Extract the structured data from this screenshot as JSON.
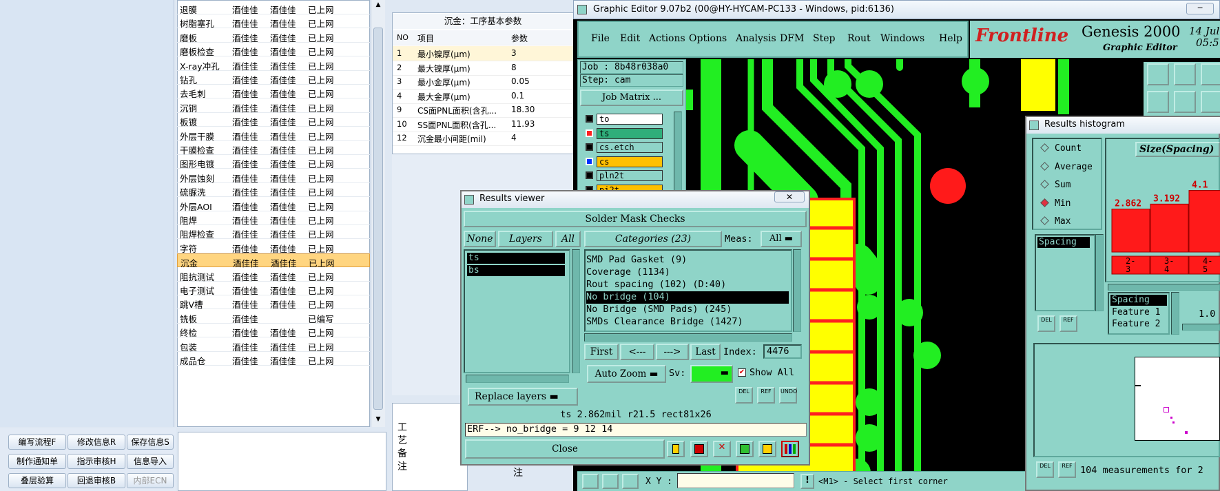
{
  "process_rows": [
    {
      "name": "退膜",
      "a": "酒佳佳",
      "b": "酒佳佳",
      "status": "已上网"
    },
    {
      "name": "树脂塞孔",
      "a": "酒佳佳",
      "b": "酒佳佳",
      "status": "已上网"
    },
    {
      "name": "磨板",
      "a": "酒佳佳",
      "b": "酒佳佳",
      "status": "已上网"
    },
    {
      "name": "磨板检查",
      "a": "酒佳佳",
      "b": "酒佳佳",
      "status": "已上网"
    },
    {
      "name": "X-ray冲孔",
      "a": "酒佳佳",
      "b": "酒佳佳",
      "status": "已上网"
    },
    {
      "name": "钻孔",
      "a": "酒佳佳",
      "b": "酒佳佳",
      "status": "已上网"
    },
    {
      "name": "去毛刺",
      "a": "酒佳佳",
      "b": "酒佳佳",
      "status": "已上网"
    },
    {
      "name": "沉铜",
      "a": "酒佳佳",
      "b": "酒佳佳",
      "status": "已上网"
    },
    {
      "name": "板镀",
      "a": "酒佳佳",
      "b": "酒佳佳",
      "status": "已上网"
    },
    {
      "name": "外层干膜",
      "a": "酒佳佳",
      "b": "酒佳佳",
      "status": "已上网"
    },
    {
      "name": "干膜检查",
      "a": "酒佳佳",
      "b": "酒佳佳",
      "status": "已上网"
    },
    {
      "name": "图形电镀",
      "a": "酒佳佳",
      "b": "酒佳佳",
      "status": "已上网"
    },
    {
      "name": "外层蚀刻",
      "a": "酒佳佳",
      "b": "酒佳佳",
      "status": "已上网"
    },
    {
      "name": "硫脲洗",
      "a": "酒佳佳",
      "b": "酒佳佳",
      "status": "已上网"
    },
    {
      "name": "外层AOI",
      "a": "酒佳佳",
      "b": "酒佳佳",
      "status": "已上网"
    },
    {
      "name": "阻焊",
      "a": "酒佳佳",
      "b": "酒佳佳",
      "status": "已上网"
    },
    {
      "name": "阻焊检查",
      "a": "酒佳佳",
      "b": "酒佳佳",
      "status": "已上网"
    },
    {
      "name": "字符",
      "a": "酒佳佳",
      "b": "酒佳佳",
      "status": "已上网"
    },
    {
      "name": "沉金",
      "a": "酒佳佳",
      "b": "酒佳佳",
      "status": "已上网"
    },
    {
      "name": "阻抗测试",
      "a": "酒佳佳",
      "b": "酒佳佳",
      "status": "已上网"
    },
    {
      "name": "电子测试",
      "a": "酒佳佳",
      "b": "酒佳佳",
      "status": "已上网"
    },
    {
      "name": "跳V槽",
      "a": "酒佳佳",
      "b": "酒佳佳",
      "status": "已上网"
    },
    {
      "name": "铣板",
      "a": "酒佳佳",
      "b": "",
      "status": "已编写"
    },
    {
      "name": "终检",
      "a": "酒佳佳",
      "b": "酒佳佳",
      "status": "已上网"
    },
    {
      "name": "包装",
      "a": "酒佳佳",
      "b": "酒佳佳",
      "status": "已上网"
    },
    {
      "name": "成品仓",
      "a": "酒佳佳",
      "b": "酒佳佳",
      "status": "已上网"
    }
  ],
  "buttons": {
    "write_flow": "编写流程F",
    "modify_info": "修改信息R",
    "save_info": "保存信息S",
    "make_notice": "制作通知单",
    "guide_review": "指示审核H",
    "import_info": "信息导入",
    "stack_calc": "叠层验算",
    "return_review": "回退审核B",
    "internal_ecn": "内部ECN"
  },
  "param": {
    "title": "沉金：工序基本参数",
    "headers": [
      "NO",
      "项目",
      "参数"
    ],
    "rows": [
      {
        "no": "1",
        "item": "最小镍厚(μm)",
        "val": "3"
      },
      {
        "no": "2",
        "item": "最大镍厚(μm)",
        "val": "8"
      },
      {
        "no": "3",
        "item": "最小金厚(μm)",
        "val": "0.05"
      },
      {
        "no": "4",
        "item": "最大金厚(μm)",
        "val": "0.1"
      },
      {
        "no": "9",
        "item": "CS面PNL面积(含孔...",
        "val": "18.30"
      },
      {
        "no": "10",
        "item": "SS面PNL面积(含孔...",
        "val": "11.93"
      },
      {
        "no": "12",
        "item": "沉金最小间距(mil)",
        "val": "4"
      }
    ],
    "craft_label": "工艺备注",
    "craft_note_char": "注"
  },
  "genesis": {
    "title": "Graphic Editor 9.07b2 (00@HY-HYCAM-PC133 - Windows, pid:6136)",
    "menu": [
      "File",
      "Edit",
      "Actions",
      "Options",
      "Analysis",
      "DFM",
      "Step",
      "Rout",
      "Windows",
      "Help"
    ],
    "brand": "Frontline",
    "product": "Genesis 2000",
    "product_sub": "Graphic Editor",
    "date": "14 Jul",
    "time": "05:5",
    "job": "Job : 8b48r038a0",
    "step": "Step: cam",
    "job_matrix": "Job Matrix ...",
    "layers": [
      {
        "name": "to",
        "color": "#ffffff",
        "box": "#000000"
      },
      {
        "name": "ts",
        "color": "#2fae7a",
        "box": "#ff2020"
      },
      {
        "name": "cs.etch",
        "color": "#8fd4c8",
        "box": "#000000"
      },
      {
        "name": "cs",
        "color": "#ffc000",
        "box": "#0033ff"
      },
      {
        "name": "pln2t",
        "color": "#8fd4c8",
        "box": "#000000"
      },
      {
        "name": "pi2t",
        "color": "#ffc000",
        "box": "#000000"
      }
    ],
    "xy_label": "X Y :",
    "status_prompt": "<M1> - Select first corner"
  },
  "results_viewer": {
    "title": "Results viewer",
    "header": "Solder Mask Checks",
    "none": "None",
    "layers": "Layers",
    "all": "All",
    "layer_items": [
      "ts",
      "bs"
    ],
    "categories_label": "Categories (23)",
    "meas_label": "Meas:",
    "meas_value": "All",
    "categories": [
      {
        "text": "SMD Pad Gasket (9)",
        "sel": false
      },
      {
        "text": "Coverage (1134)",
        "sel": false
      },
      {
        "text": "Rout spacing (102)          (D:40)",
        "sel": false
      },
      {
        "text": "No bridge (104)",
        "sel": true
      },
      {
        "text": "No Bridge (SMD Pads) (245)",
        "sel": false
      },
      {
        "text": "SMDs Clearance Bridge (1427)",
        "sel": false
      }
    ],
    "first": "First",
    "prev": "<---",
    "next": "--->",
    "last": "Last",
    "index_label": "Index:",
    "index_value": "4476",
    "auto_zoom": "Auto Zoom",
    "sv_label": "Sv:",
    "show_all": "Show All",
    "replace_layers": "Replace layers",
    "status_line": "ts 2.862mil  r21.5  rect81x26",
    "erf_line": "ERF--> no_bridge = 9 12 14",
    "close": "Close",
    "del": "DEL",
    "ref": "REF",
    "undo": "UNDO"
  },
  "histogram": {
    "title": "Results histogram",
    "options": [
      {
        "label": "Count",
        "on": false
      },
      {
        "label": "Average",
        "on": false
      },
      {
        "label": "Sum",
        "on": false
      },
      {
        "label": "Min",
        "on": true
      },
      {
        "label": "Max",
        "on": false
      }
    ],
    "axis_title": "Size(Spacing)",
    "list1": [
      "Spacing"
    ],
    "list2": [
      "Spacing",
      "Feature 1",
      "Feature 2"
    ],
    "value_1_0": "1.0",
    "footer": "104 measurements for 2",
    "del": "DEL",
    "ref": "REF"
  },
  "chart_data": {
    "type": "bar",
    "title": "Size(Spacing)",
    "categories": [
      "2-3",
      "3-4",
      "4-5"
    ],
    "values": [
      2.862,
      3.192,
      4.1
    ],
    "value_labels": [
      "2.862",
      "3.192",
      "4.1"
    ]
  }
}
